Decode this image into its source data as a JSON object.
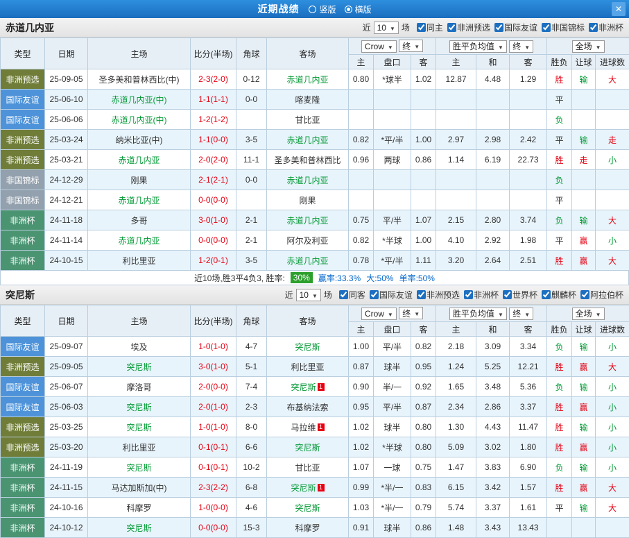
{
  "titlebar": {
    "title": "近期战绩",
    "layout_options": [
      {
        "label": "竖版",
        "selected": false
      },
      {
        "label": "横版",
        "selected": true
      }
    ],
    "close_glyph": "✕"
  },
  "filter_labels": {
    "near": "近",
    "matches": "场"
  },
  "table_header": {
    "type": "类型",
    "date": "日期",
    "home": "主场",
    "score": "比分(半场)",
    "corner": "角球",
    "away": "客场",
    "odds_source": "Crow",
    "odds_final": "终",
    "avg_label": "胜平负均值",
    "avg_final": "终",
    "scope_label": "全场",
    "sub_home": "主",
    "sub_handicap": "盘口",
    "sub_away": "客",
    "sub_avg_home": "主",
    "sub_avg_draw": "和",
    "sub_avg_away": "客",
    "sub_result": "胜负",
    "sub_asian": "让球",
    "sub_goals": "进球数"
  },
  "type_colors": {
    "非洲预选": "#6f7d39",
    "国际友谊": "#4e93d9",
    "非国锦标": "#93a0ad",
    "非洲杯": "#4a9472"
  },
  "result_colors": {
    "r": "#e60012",
    "g": "#009933",
    "k": "#333333"
  },
  "colors": {
    "titlebar_blue": "#1f7fd1",
    "score_red": "#e60012",
    "team_green": "#009933",
    "alt_row": "#e8f4fc",
    "win_rate_badge": "#2ba02b",
    "stat_blue": "#0066cc"
  },
  "sections": [
    {
      "team": "赤道几内亚",
      "near_value": "10",
      "filters": [
        "同主",
        "非洲预选",
        "国际友谊",
        "非国锦标",
        "非洲杯"
      ],
      "rows": [
        {
          "type": "非洲预选",
          "date": "25-09-05",
          "home": "圣多美和普林西比(中)",
          "home_hl": false,
          "home_badge": "",
          "score": "2-3(2-0)",
          "corner": "0-12",
          "away": "赤道几内亚",
          "away_hl": true,
          "away_badge": "",
          "odds": [
            "0.80",
            "*球半",
            "1.02"
          ],
          "avg": [
            "12.87",
            "4.48",
            "1.29"
          ],
          "res": [
            "胜",
            "输",
            "大"
          ],
          "res_c": [
            "r",
            "g",
            "r"
          ]
        },
        {
          "type": "国际友谊",
          "date": "25-06-10",
          "home": "赤道几内亚(中)",
          "home_hl": true,
          "home_badge": "",
          "score": "1-1(1-1)",
          "corner": "0-0",
          "away": "喀麦隆",
          "away_hl": false,
          "away_badge": "",
          "odds": [
            "",
            "",
            ""
          ],
          "avg": [
            "",
            "",
            ""
          ],
          "res": [
            "平",
            "",
            ""
          ],
          "res_c": [
            "k",
            "",
            ""
          ]
        },
        {
          "type": "国际友谊",
          "date": "25-06-06",
          "home": "赤道几内亚(中)",
          "home_hl": true,
          "home_badge": "",
          "score": "1-2(1-2)",
          "corner": "",
          "away": "甘比亚",
          "away_hl": false,
          "away_badge": "",
          "odds": [
            "",
            "",
            ""
          ],
          "avg": [
            "",
            "",
            ""
          ],
          "res": [
            "负",
            "",
            ""
          ],
          "res_c": [
            "g",
            "",
            ""
          ]
        },
        {
          "type": "非洲预选",
          "date": "25-03-24",
          "home": "纳米比亚(中)",
          "home_hl": false,
          "home_badge": "",
          "score": "1-1(0-0)",
          "corner": "3-5",
          "away": "赤道几内亚",
          "away_hl": true,
          "away_badge": "",
          "odds": [
            "0.82",
            "*平/半",
            "1.00"
          ],
          "avg": [
            "2.97",
            "2.98",
            "2.42"
          ],
          "res": [
            "平",
            "输",
            "走"
          ],
          "res_c": [
            "k",
            "g",
            "r"
          ]
        },
        {
          "type": "非洲预选",
          "date": "25-03-21",
          "home": "赤道几内亚",
          "home_hl": true,
          "home_badge": "",
          "score": "2-0(2-0)",
          "corner": "11-1",
          "away": "圣多美和普林西比",
          "away_hl": false,
          "away_badge": "",
          "odds": [
            "0.96",
            "两球",
            "0.86"
          ],
          "avg": [
            "1.14",
            "6.19",
            "22.73"
          ],
          "res": [
            "胜",
            "走",
            "小"
          ],
          "res_c": [
            "r",
            "r",
            "g"
          ]
        },
        {
          "type": "非国锦标",
          "date": "24-12-29",
          "home": "刚果",
          "home_hl": false,
          "home_badge": "",
          "score": "2-1(2-1)",
          "corner": "0-0",
          "away": "赤道几内亚",
          "away_hl": true,
          "away_badge": "",
          "odds": [
            "",
            "",
            ""
          ],
          "avg": [
            "",
            "",
            ""
          ],
          "res": [
            "负",
            "",
            ""
          ],
          "res_c": [
            "g",
            "",
            ""
          ]
        },
        {
          "type": "非国锦标",
          "date": "24-12-21",
          "home": "赤道几内亚",
          "home_hl": true,
          "home_badge": "",
          "score": "0-0(0-0)",
          "corner": "",
          "away": "刚果",
          "away_hl": false,
          "away_badge": "",
          "odds": [
            "",
            "",
            ""
          ],
          "avg": [
            "",
            "",
            ""
          ],
          "res": [
            "平",
            "",
            ""
          ],
          "res_c": [
            "k",
            "",
            ""
          ]
        },
        {
          "type": "非洲杯",
          "date": "24-11-18",
          "home": "多哥",
          "home_hl": false,
          "home_badge": "",
          "score": "3-0(1-0)",
          "corner": "2-1",
          "away": "赤道几内亚",
          "away_hl": true,
          "away_badge": "",
          "odds": [
            "0.75",
            "平/半",
            "1.07"
          ],
          "avg": [
            "2.15",
            "2.80",
            "3.74"
          ],
          "res": [
            "负",
            "输",
            "大"
          ],
          "res_c": [
            "g",
            "g",
            "r"
          ]
        },
        {
          "type": "非洲杯",
          "date": "24-11-14",
          "home": "赤道几内亚",
          "home_hl": true,
          "home_badge": "",
          "score": "0-0(0-0)",
          "corner": "2-1",
          "away": "阿尔及利亚",
          "away_hl": false,
          "away_badge": "",
          "odds": [
            "0.82",
            "*半球",
            "1.00"
          ],
          "avg": [
            "4.10",
            "2.92",
            "1.98"
          ],
          "res": [
            "平",
            "赢",
            "小"
          ],
          "res_c": [
            "k",
            "r",
            "g"
          ]
        },
        {
          "type": "非洲杯",
          "date": "24-10-15",
          "home": "利比里亚",
          "home_hl": false,
          "home_badge": "",
          "score": "1-2(0-1)",
          "corner": "3-5",
          "away": "赤道几内亚",
          "away_hl": true,
          "away_badge": "",
          "odds": [
            "0.78",
            "*平/半",
            "1.11"
          ],
          "avg": [
            "3.20",
            "2.64",
            "2.51"
          ],
          "res": [
            "胜",
            "赢",
            "大"
          ],
          "res_c": [
            "r",
            "r",
            "r"
          ]
        }
      ],
      "summary": {
        "prefix": "近10场,胜3平4负3, 胜率:",
        "win_rate": "30%",
        "stats": [
          "赢率:33.3%",
          "大:50%",
          "单率:50%"
        ]
      }
    },
    {
      "team": "突尼斯",
      "near_value": "10",
      "filters": [
        "同客",
        "国际友谊",
        "非洲预选",
        "非洲杯",
        "世界杯",
        "麒麟杯",
        "阿拉伯杯"
      ],
      "rows": [
        {
          "type": "国际友谊",
          "date": "25-09-07",
          "home": "埃及",
          "home_hl": false,
          "home_badge": "",
          "score": "1-0(1-0)",
          "corner": "4-7",
          "away": "突尼斯",
          "away_hl": true,
          "away_badge": "",
          "odds": [
            "1.00",
            "平/半",
            "0.82"
          ],
          "avg": [
            "2.18",
            "3.09",
            "3.34"
          ],
          "res": [
            "负",
            "输",
            "小"
          ],
          "res_c": [
            "g",
            "g",
            "g"
          ]
        },
        {
          "type": "非洲预选",
          "date": "25-09-05",
          "home": "突尼斯",
          "home_hl": true,
          "home_badge": "",
          "score": "3-0(1-0)",
          "corner": "5-1",
          "away": "利比里亚",
          "away_hl": false,
          "away_badge": "",
          "odds": [
            "0.87",
            "球半",
            "0.95"
          ],
          "avg": [
            "1.24",
            "5.25",
            "12.21"
          ],
          "res": [
            "胜",
            "赢",
            "大"
          ],
          "res_c": [
            "r",
            "r",
            "r"
          ]
        },
        {
          "type": "国际友谊",
          "date": "25-06-07",
          "home": "摩洛哥",
          "home_hl": false,
          "home_badge": "",
          "score": "2-0(0-0)",
          "corner": "7-4",
          "away": "突尼斯",
          "away_hl": true,
          "away_badge": "1",
          "odds": [
            "0.90",
            "半/一",
            "0.92"
          ],
          "avg": [
            "1.65",
            "3.48",
            "5.36"
          ],
          "res": [
            "负",
            "输",
            "小"
          ],
          "res_c": [
            "g",
            "g",
            "g"
          ]
        },
        {
          "type": "国际友谊",
          "date": "25-06-03",
          "home": "突尼斯",
          "home_hl": true,
          "home_badge": "",
          "score": "2-0(1-0)",
          "corner": "2-3",
          "away": "布基纳法索",
          "away_hl": false,
          "away_badge": "",
          "odds": [
            "0.95",
            "平/半",
            "0.87"
          ],
          "avg": [
            "2.34",
            "2.86",
            "3.37"
          ],
          "res": [
            "胜",
            "赢",
            "小"
          ],
          "res_c": [
            "r",
            "r",
            "g"
          ]
        },
        {
          "type": "非洲预选",
          "date": "25-03-25",
          "home": "突尼斯",
          "home_hl": true,
          "home_badge": "",
          "score": "1-0(1-0)",
          "corner": "8-0",
          "away": "马拉维",
          "away_hl": false,
          "away_badge": "1",
          "odds": [
            "1.02",
            "球半",
            "0.80"
          ],
          "avg": [
            "1.30",
            "4.43",
            "11.47"
          ],
          "res": [
            "胜",
            "输",
            "小"
          ],
          "res_c": [
            "r",
            "g",
            "g"
          ]
        },
        {
          "type": "非洲预选",
          "date": "25-03-20",
          "home": "利比里亚",
          "home_hl": false,
          "home_badge": "",
          "score": "0-1(0-1)",
          "corner": "6-6",
          "away": "突尼斯",
          "away_hl": true,
          "away_badge": "",
          "odds": [
            "1.02",
            "*半球",
            "0.80"
          ],
          "avg": [
            "5.09",
            "3.02",
            "1.80"
          ],
          "res": [
            "胜",
            "赢",
            "小"
          ],
          "res_c": [
            "r",
            "r",
            "g"
          ]
        },
        {
          "type": "非洲杯",
          "date": "24-11-19",
          "home": "突尼斯",
          "home_hl": true,
          "home_badge": "",
          "score": "0-1(0-1)",
          "corner": "10-2",
          "away": "甘比亚",
          "away_hl": false,
          "away_badge": "",
          "odds": [
            "1.07",
            "一球",
            "0.75"
          ],
          "avg": [
            "1.47",
            "3.83",
            "6.90"
          ],
          "res": [
            "负",
            "输",
            "小"
          ],
          "res_c": [
            "g",
            "g",
            "g"
          ]
        },
        {
          "type": "非洲杯",
          "date": "24-11-15",
          "home": "马达加斯加(中)",
          "home_hl": false,
          "home_badge": "",
          "score": "2-3(2-2)",
          "corner": "6-8",
          "away": "突尼斯",
          "away_hl": true,
          "away_badge": "1",
          "odds": [
            "0.99",
            "*半/一",
            "0.83"
          ],
          "avg": [
            "6.15",
            "3.42",
            "1.57"
          ],
          "res": [
            "胜",
            "赢",
            "大"
          ],
          "res_c": [
            "r",
            "r",
            "r"
          ]
        },
        {
          "type": "非洲杯",
          "date": "24-10-16",
          "home": "科摩罗",
          "home_hl": false,
          "home_badge": "",
          "score": "1-0(0-0)",
          "corner": "4-6",
          "away": "突尼斯",
          "away_hl": true,
          "away_badge": "",
          "odds": [
            "1.03",
            "*半/一",
            "0.79"
          ],
          "avg": [
            "5.74",
            "3.37",
            "1.61"
          ],
          "res": [
            "平",
            "输",
            "大"
          ],
          "res_c": [
            "k",
            "g",
            "r"
          ]
        },
        {
          "type": "非洲杯",
          "date": "24-10-12",
          "home": "突尼斯",
          "home_hl": true,
          "home_badge": "",
          "score": "0-0(0-0)",
          "corner": "15-3",
          "away": "科摩罗",
          "away_hl": false,
          "away_badge": "",
          "odds": [
            "0.91",
            "球半",
            "0.86"
          ],
          "avg": [
            "1.48",
            "3.43",
            "13.43"
          ],
          "res": [
            "",
            "",
            ""
          ],
          "res_c": [
            "",
            "",
            ""
          ]
        }
      ],
      "summary": null
    }
  ]
}
